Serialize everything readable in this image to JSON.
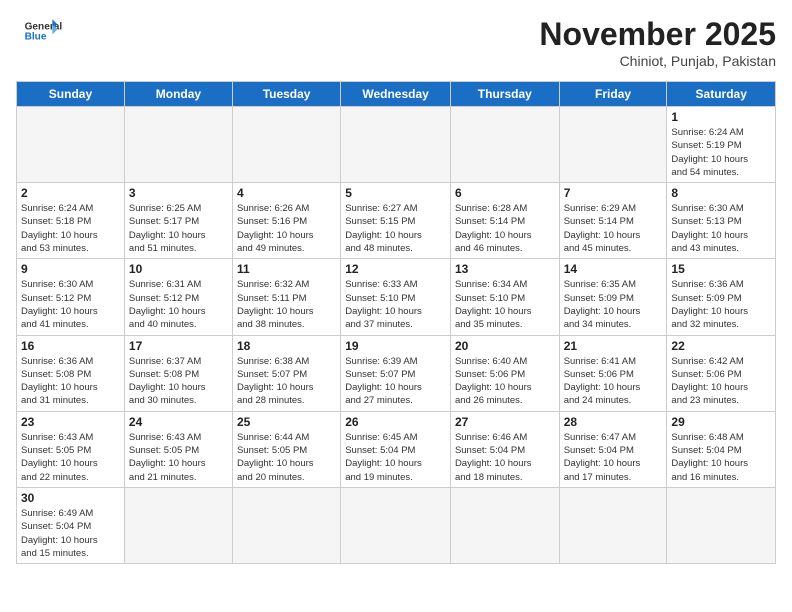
{
  "header": {
    "logo_general": "General",
    "logo_blue": "Blue",
    "month_year": "November 2025",
    "location": "Chiniot, Punjab, Pakistan"
  },
  "weekdays": [
    "Sunday",
    "Monday",
    "Tuesday",
    "Wednesday",
    "Thursday",
    "Friday",
    "Saturday"
  ],
  "weeks": [
    [
      {
        "day": "",
        "info": ""
      },
      {
        "day": "",
        "info": ""
      },
      {
        "day": "",
        "info": ""
      },
      {
        "day": "",
        "info": ""
      },
      {
        "day": "",
        "info": ""
      },
      {
        "day": "",
        "info": ""
      },
      {
        "day": "1",
        "info": "Sunrise: 6:24 AM\nSunset: 5:19 PM\nDaylight: 10 hours\nand 54 minutes."
      }
    ],
    [
      {
        "day": "2",
        "info": "Sunrise: 6:24 AM\nSunset: 5:18 PM\nDaylight: 10 hours\nand 53 minutes."
      },
      {
        "day": "3",
        "info": "Sunrise: 6:25 AM\nSunset: 5:17 PM\nDaylight: 10 hours\nand 51 minutes."
      },
      {
        "day": "4",
        "info": "Sunrise: 6:26 AM\nSunset: 5:16 PM\nDaylight: 10 hours\nand 49 minutes."
      },
      {
        "day": "5",
        "info": "Sunrise: 6:27 AM\nSunset: 5:15 PM\nDaylight: 10 hours\nand 48 minutes."
      },
      {
        "day": "6",
        "info": "Sunrise: 6:28 AM\nSunset: 5:14 PM\nDaylight: 10 hours\nand 46 minutes."
      },
      {
        "day": "7",
        "info": "Sunrise: 6:29 AM\nSunset: 5:14 PM\nDaylight: 10 hours\nand 45 minutes."
      },
      {
        "day": "8",
        "info": "Sunrise: 6:30 AM\nSunset: 5:13 PM\nDaylight: 10 hours\nand 43 minutes."
      }
    ],
    [
      {
        "day": "9",
        "info": "Sunrise: 6:30 AM\nSunset: 5:12 PM\nDaylight: 10 hours\nand 41 minutes."
      },
      {
        "day": "10",
        "info": "Sunrise: 6:31 AM\nSunset: 5:12 PM\nDaylight: 10 hours\nand 40 minutes."
      },
      {
        "day": "11",
        "info": "Sunrise: 6:32 AM\nSunset: 5:11 PM\nDaylight: 10 hours\nand 38 minutes."
      },
      {
        "day": "12",
        "info": "Sunrise: 6:33 AM\nSunset: 5:10 PM\nDaylight: 10 hours\nand 37 minutes."
      },
      {
        "day": "13",
        "info": "Sunrise: 6:34 AM\nSunset: 5:10 PM\nDaylight: 10 hours\nand 35 minutes."
      },
      {
        "day": "14",
        "info": "Sunrise: 6:35 AM\nSunset: 5:09 PM\nDaylight: 10 hours\nand 34 minutes."
      },
      {
        "day": "15",
        "info": "Sunrise: 6:36 AM\nSunset: 5:09 PM\nDaylight: 10 hours\nand 32 minutes."
      }
    ],
    [
      {
        "day": "16",
        "info": "Sunrise: 6:36 AM\nSunset: 5:08 PM\nDaylight: 10 hours\nand 31 minutes."
      },
      {
        "day": "17",
        "info": "Sunrise: 6:37 AM\nSunset: 5:08 PM\nDaylight: 10 hours\nand 30 minutes."
      },
      {
        "day": "18",
        "info": "Sunrise: 6:38 AM\nSunset: 5:07 PM\nDaylight: 10 hours\nand 28 minutes."
      },
      {
        "day": "19",
        "info": "Sunrise: 6:39 AM\nSunset: 5:07 PM\nDaylight: 10 hours\nand 27 minutes."
      },
      {
        "day": "20",
        "info": "Sunrise: 6:40 AM\nSunset: 5:06 PM\nDaylight: 10 hours\nand 26 minutes."
      },
      {
        "day": "21",
        "info": "Sunrise: 6:41 AM\nSunset: 5:06 PM\nDaylight: 10 hours\nand 24 minutes."
      },
      {
        "day": "22",
        "info": "Sunrise: 6:42 AM\nSunset: 5:06 PM\nDaylight: 10 hours\nand 23 minutes."
      }
    ],
    [
      {
        "day": "23",
        "info": "Sunrise: 6:43 AM\nSunset: 5:05 PM\nDaylight: 10 hours\nand 22 minutes."
      },
      {
        "day": "24",
        "info": "Sunrise: 6:43 AM\nSunset: 5:05 PM\nDaylight: 10 hours\nand 21 minutes."
      },
      {
        "day": "25",
        "info": "Sunrise: 6:44 AM\nSunset: 5:05 PM\nDaylight: 10 hours\nand 20 minutes."
      },
      {
        "day": "26",
        "info": "Sunrise: 6:45 AM\nSunset: 5:04 PM\nDaylight: 10 hours\nand 19 minutes."
      },
      {
        "day": "27",
        "info": "Sunrise: 6:46 AM\nSunset: 5:04 PM\nDaylight: 10 hours\nand 18 minutes."
      },
      {
        "day": "28",
        "info": "Sunrise: 6:47 AM\nSunset: 5:04 PM\nDaylight: 10 hours\nand 17 minutes."
      },
      {
        "day": "29",
        "info": "Sunrise: 6:48 AM\nSunset: 5:04 PM\nDaylight: 10 hours\nand 16 minutes."
      }
    ],
    [
      {
        "day": "30",
        "info": "Sunrise: 6:49 AM\nSunset: 5:04 PM\nDaylight: 10 hours\nand 15 minutes."
      },
      {
        "day": "",
        "info": ""
      },
      {
        "day": "",
        "info": ""
      },
      {
        "day": "",
        "info": ""
      },
      {
        "day": "",
        "info": ""
      },
      {
        "day": "",
        "info": ""
      },
      {
        "day": "",
        "info": ""
      }
    ]
  ]
}
